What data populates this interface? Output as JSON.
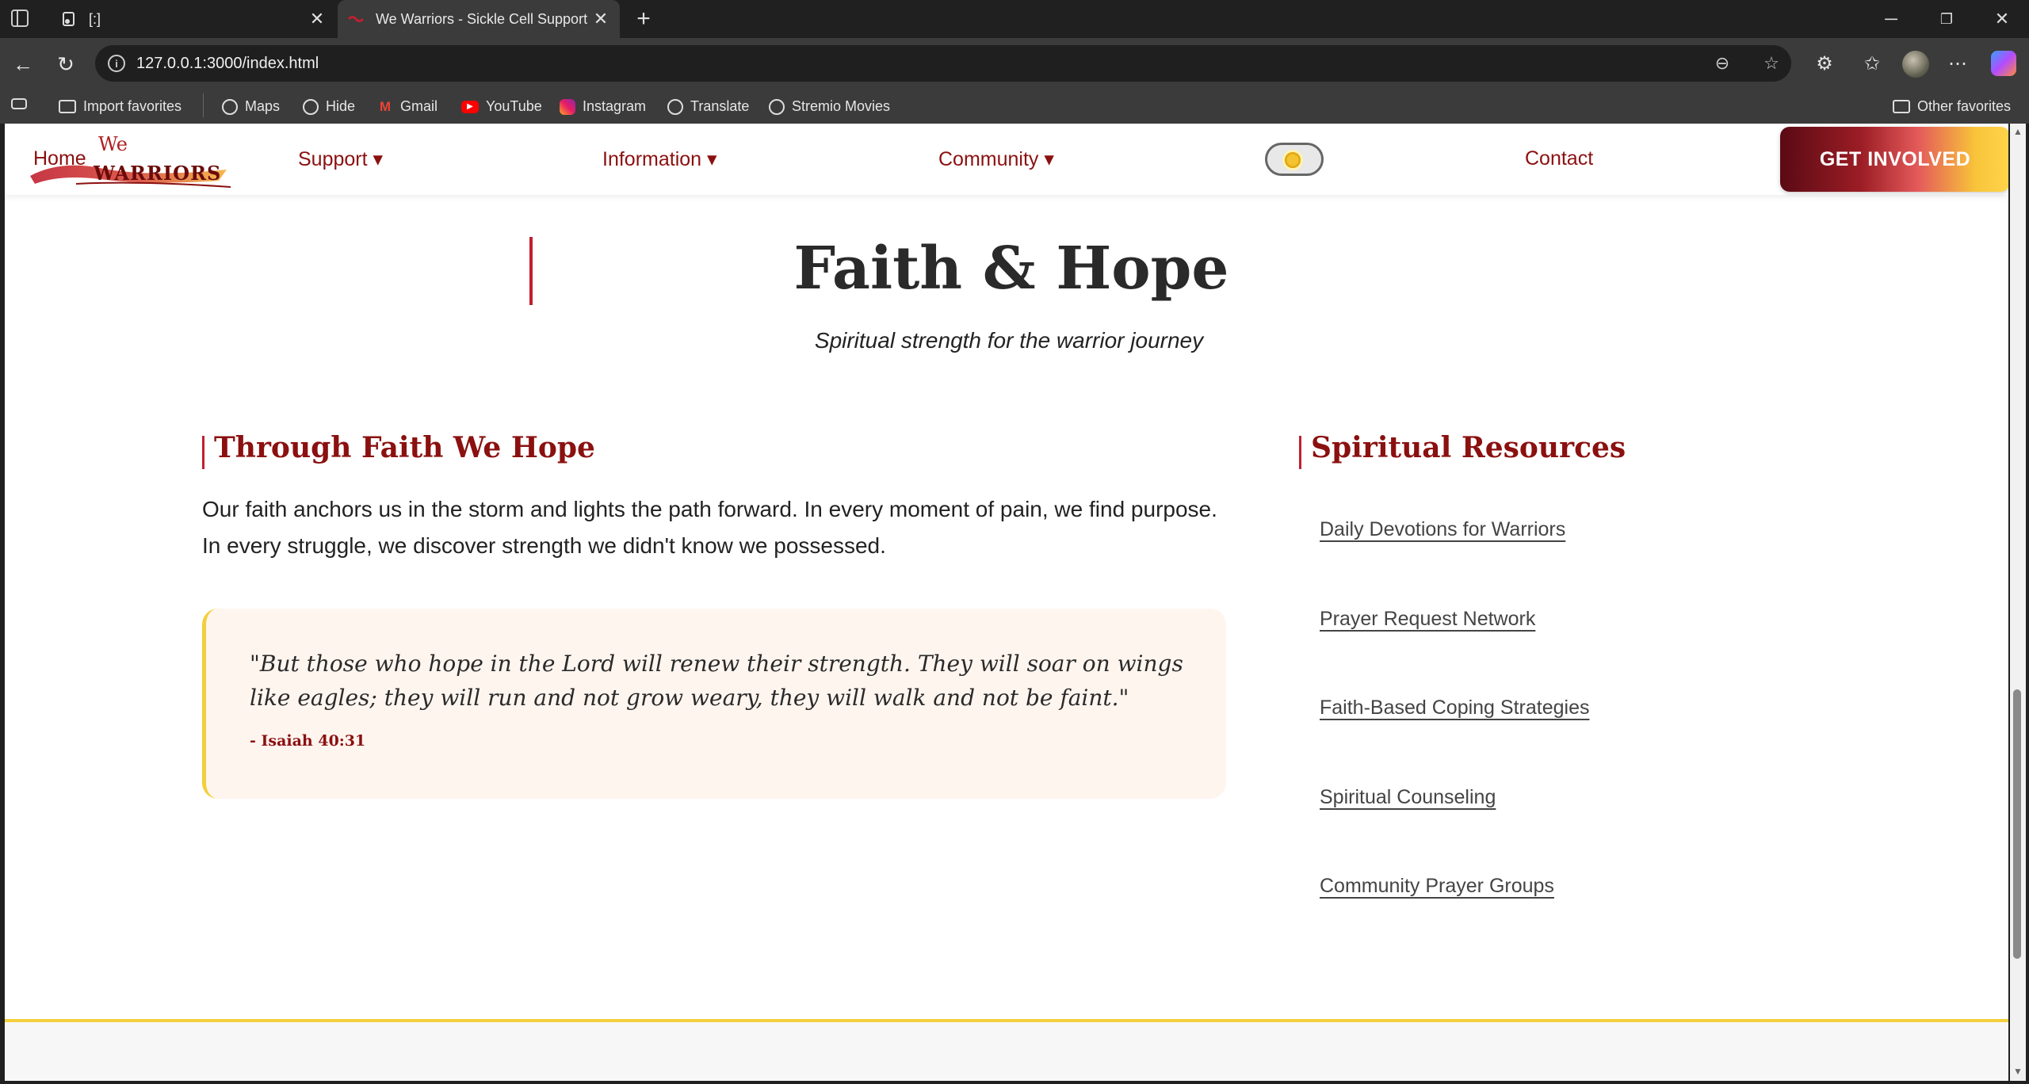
{
  "browser": {
    "tabs": [
      {
        "title": "[:]"
      },
      {
        "title": "We Warriors - Sickle Cell Support"
      }
    ],
    "url": "127.0.0.1:3000/index.html",
    "bookmarks": [
      {
        "label": "Import favorites",
        "icon": "folder-icon"
      },
      {
        "label": "Maps",
        "icon": "globe-icon"
      },
      {
        "label": "Hide",
        "icon": "globe-icon"
      },
      {
        "label": "Gmail",
        "icon": "gmail-icon"
      },
      {
        "label": "YouTube",
        "icon": "youtube-icon"
      },
      {
        "label": "Instagram",
        "icon": "instagram-icon"
      },
      {
        "label": "Translate",
        "icon": "globe-icon"
      },
      {
        "label": "Stremio Movies",
        "icon": "globe-icon"
      }
    ],
    "other_favorites": "Other favorites"
  },
  "site": {
    "logo": {
      "we": "We",
      "warriors": "WARRIORS"
    },
    "nav": {
      "home": "Home",
      "support": "Support ▾",
      "information": "Information ▾",
      "community": "Community ▾",
      "contact": "Contact"
    },
    "cta": "GET INVOLVED"
  },
  "main": {
    "title": "Faith & Hope",
    "subtitle": "Spiritual strength for the warrior journey",
    "faith_section": {
      "heading": "Through Faith We Hope",
      "paragraph": "Our faith anchors us in the storm and lights the path forward. In every moment of pain, we find purpose. In every struggle, we discover strength we didn't know we possessed.",
      "quote": "\"But those who hope in the Lord will renew their strength. They will soar on wings like eagles; they will run and not grow weary, they will walk and not be faint.\"",
      "citation": "- Isaiah 40:31"
    },
    "resources": {
      "heading": "Spiritual Resources",
      "links": [
        "Daily Devotions for Warriors",
        "Prayer Request Network",
        "Faith-Based Coping Strategies",
        "Spiritual Counseling",
        "Community Prayer Groups"
      ]
    }
  },
  "colors": {
    "brand": "#8b1010",
    "accent_bar": "#c02030",
    "gold": "#f3cf3c",
    "quote_bg": "#fff5ef"
  }
}
